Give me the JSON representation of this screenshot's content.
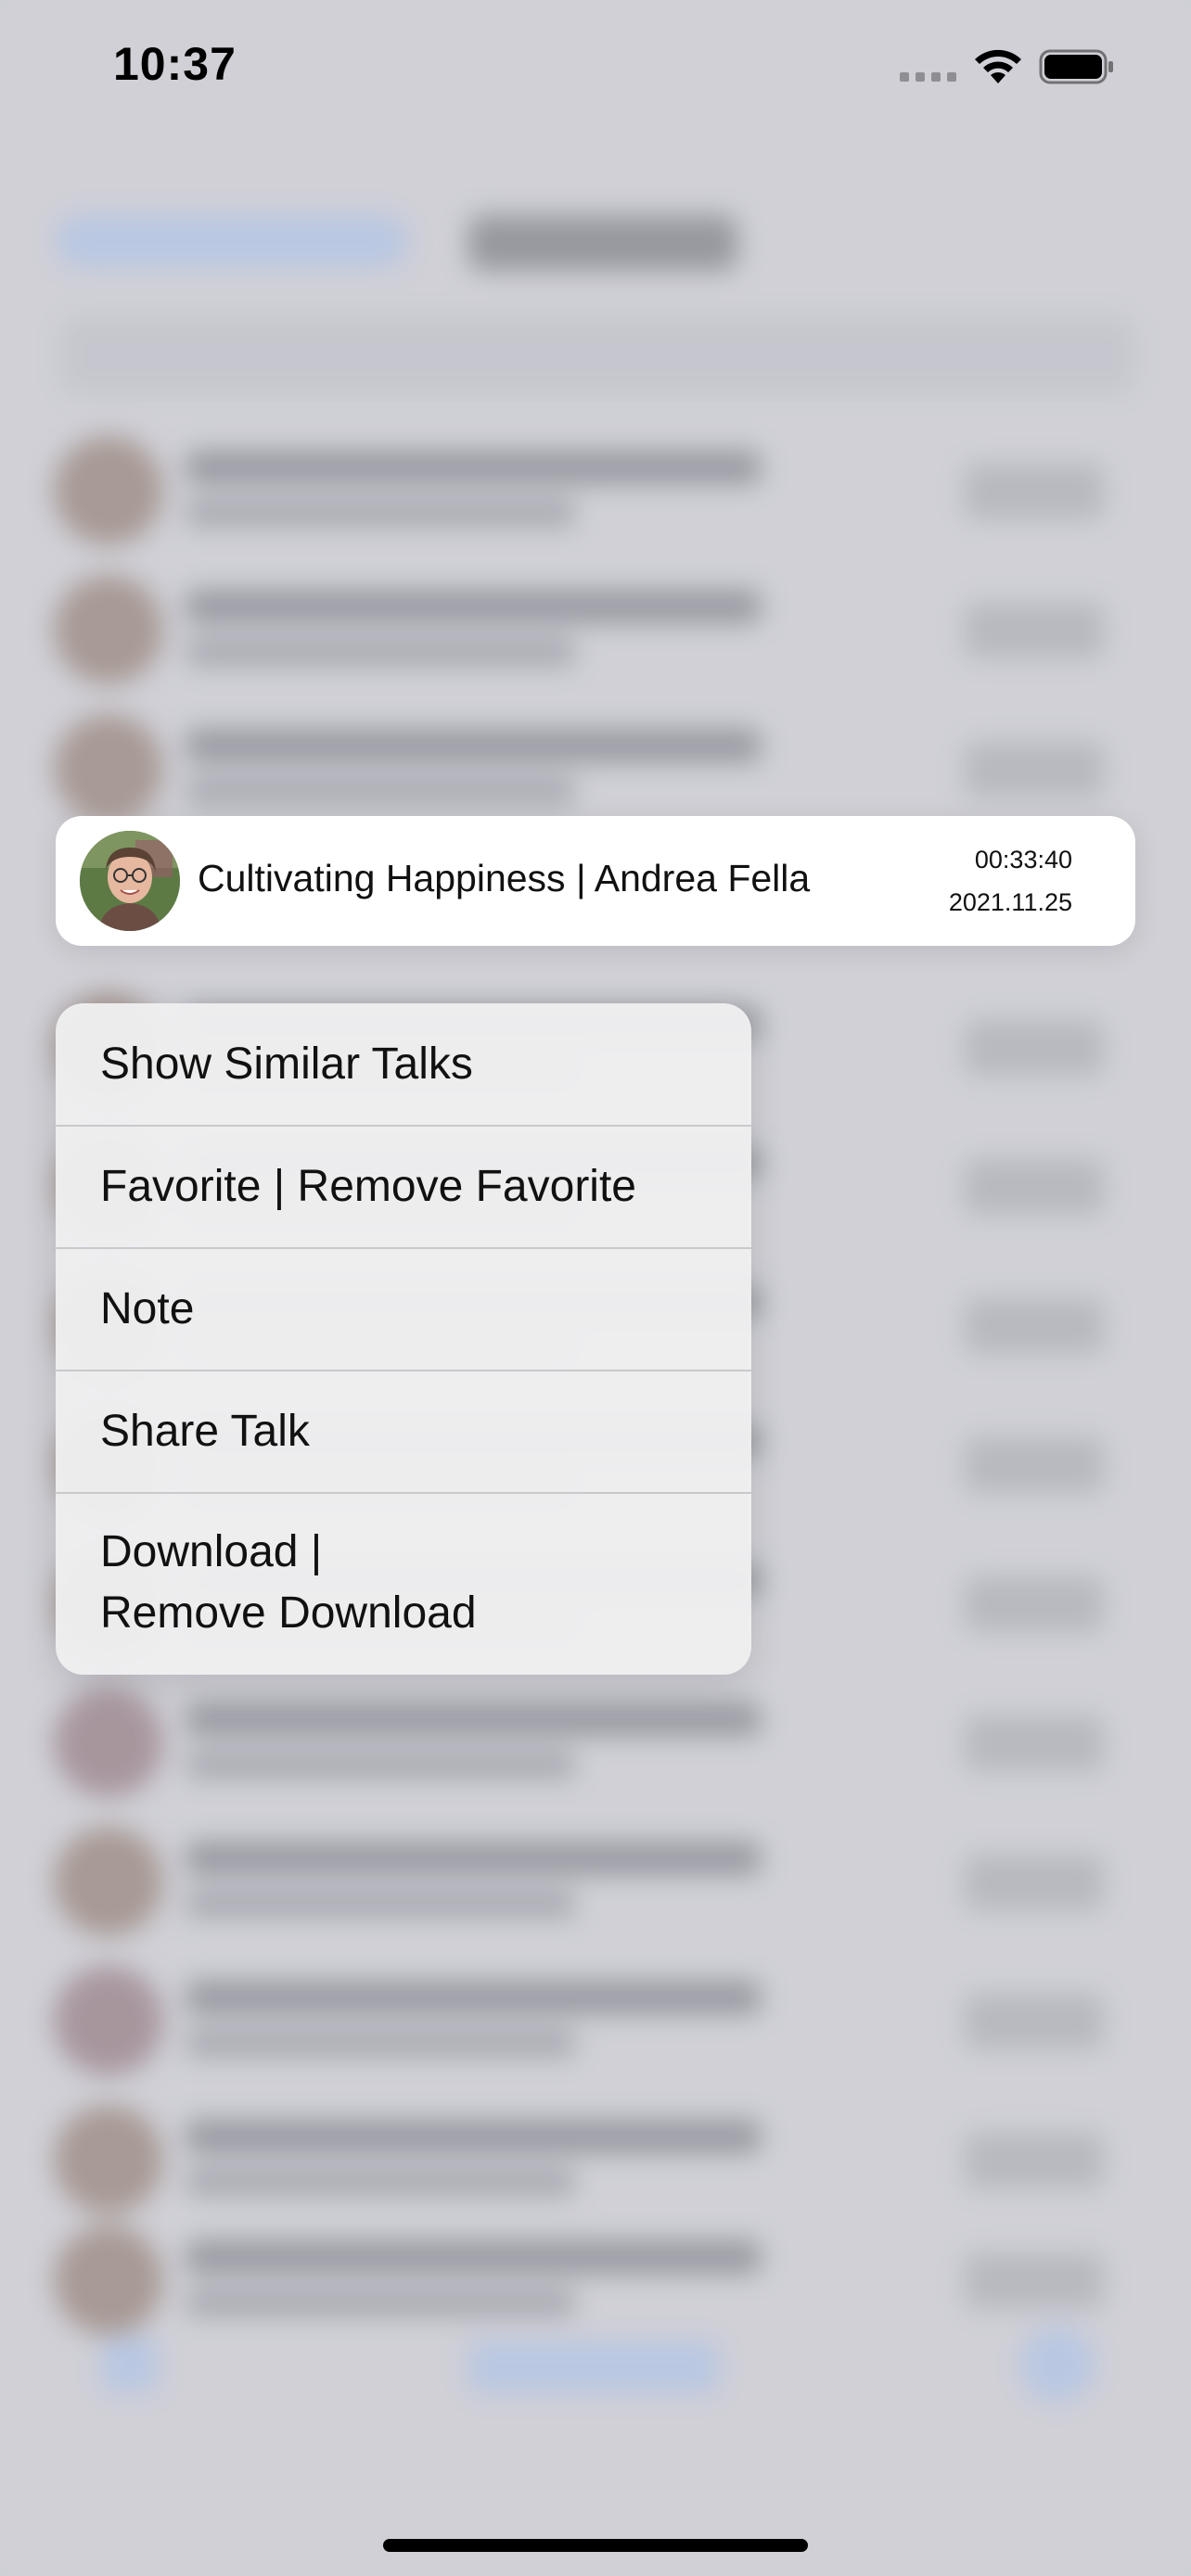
{
  "status_bar": {
    "time": "10:37"
  },
  "preview": {
    "title": "Cultivating Happiness | Andrea Fella",
    "duration": "00:33:40",
    "date": "2021.11.25",
    "avatar_icon": "speaker-portrait"
  },
  "menu": {
    "items": [
      {
        "label": "Show Similar Talks"
      },
      {
        "label": "Favorite | Remove Favorite"
      },
      {
        "label": "Note"
      },
      {
        "label": "Share Talk"
      },
      {
        "label": "Download |\nRemove Download"
      }
    ]
  },
  "colors": {
    "accent": "#a9c4ee",
    "menu_background": "#eeeef0",
    "backdrop": "#d2d2d7"
  }
}
